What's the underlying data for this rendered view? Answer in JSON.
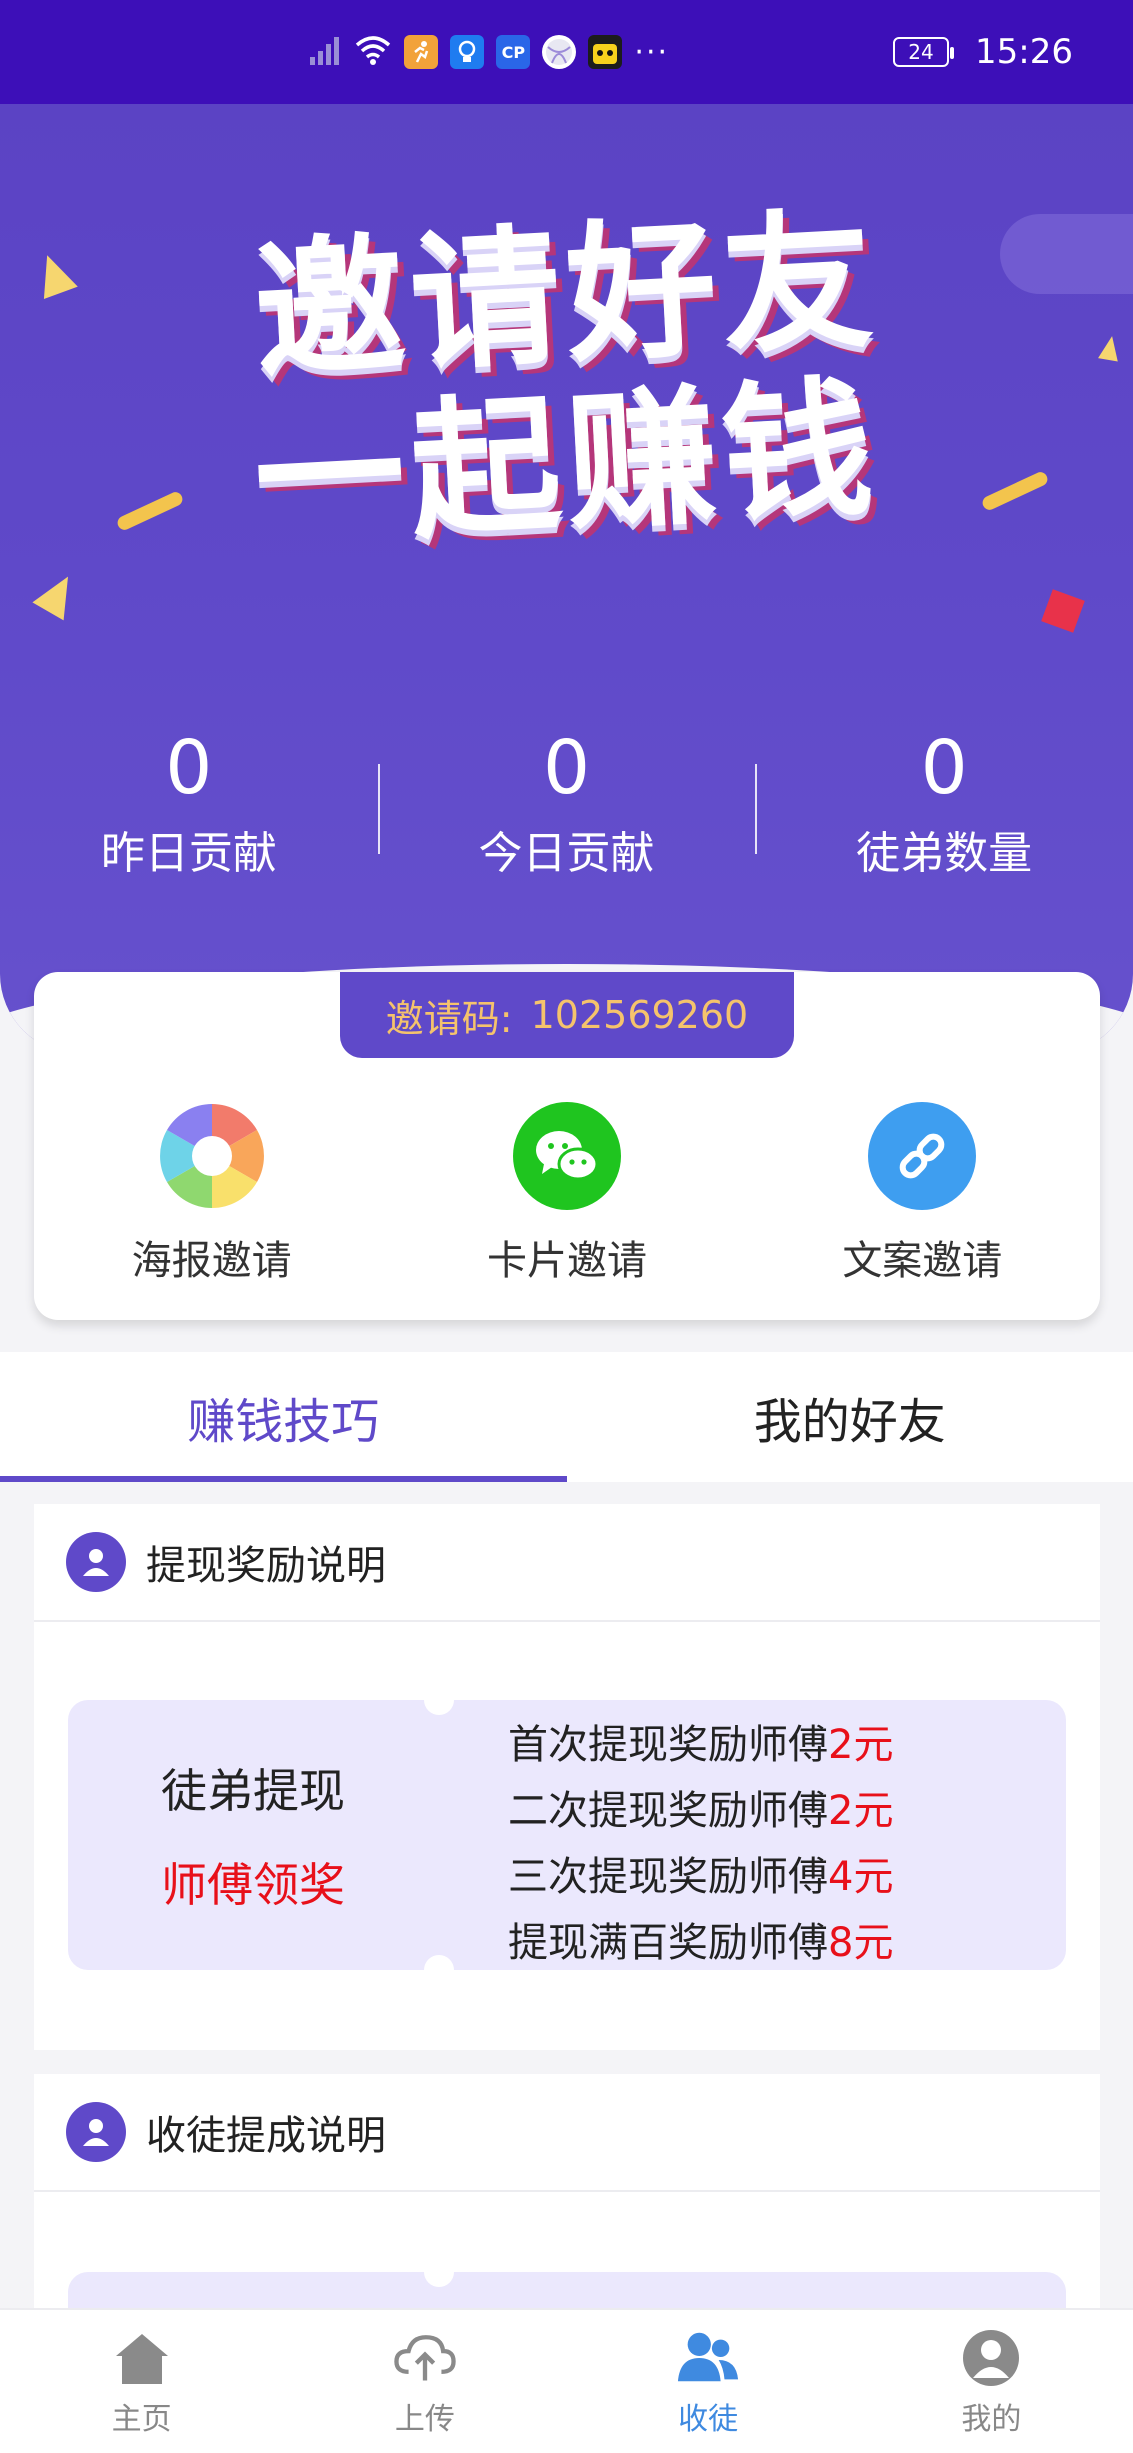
{
  "status_bar": {
    "battery": "24",
    "time": "15:26",
    "overflow": "···"
  },
  "hero": {
    "title_line1": "邀请好友",
    "title_line2": "一起赚钱"
  },
  "stats": [
    {
      "value": "0",
      "label": "昨日贡献"
    },
    {
      "value": "0",
      "label": "今日贡献"
    },
    {
      "value": "0",
      "label": "徒弟数量"
    }
  ],
  "invite": {
    "code_label": "邀请码:",
    "code_value": "102569260",
    "share_options": [
      {
        "label": "海报邀请",
        "icon": "camera-shutter-icon"
      },
      {
        "label": "卡片邀请",
        "icon": "wechat-icon"
      },
      {
        "label": "文案邀请",
        "icon": "link-icon"
      }
    ]
  },
  "tabs": [
    {
      "label": "赚钱技巧",
      "active": true
    },
    {
      "label": "我的好友",
      "active": false
    }
  ],
  "withdraw_card": {
    "title": "提现奖励说明",
    "left_line1": "徒弟提现",
    "left_line2": "师傅领奖",
    "rules": [
      {
        "text": "首次提现奖励师傅",
        "amount": "2元"
      },
      {
        "text": "二次提现奖励师傅",
        "amount": "2元"
      },
      {
        "text": "三次提现奖励师傅",
        "amount": "4元"
      },
      {
        "text": "提现满百奖励师傅",
        "amount": "8元"
      }
    ]
  },
  "commission_card": {
    "title": "收徒提成说明"
  },
  "bottom_nav": [
    {
      "label": "主页",
      "icon": "home-icon",
      "active": false
    },
    {
      "label": "上传",
      "icon": "cloud-upload-icon",
      "active": false
    },
    {
      "label": "收徒",
      "icon": "users-icon",
      "active": true
    },
    {
      "label": "我的",
      "icon": "user-icon",
      "active": false
    }
  ],
  "colors": {
    "status_bar": "#3d0fb8",
    "brand_purple": "#5f49c9",
    "invite_code_text": "#f5c36c",
    "reward_red": "#e8101a",
    "nav_active": "#3f8ae0"
  }
}
